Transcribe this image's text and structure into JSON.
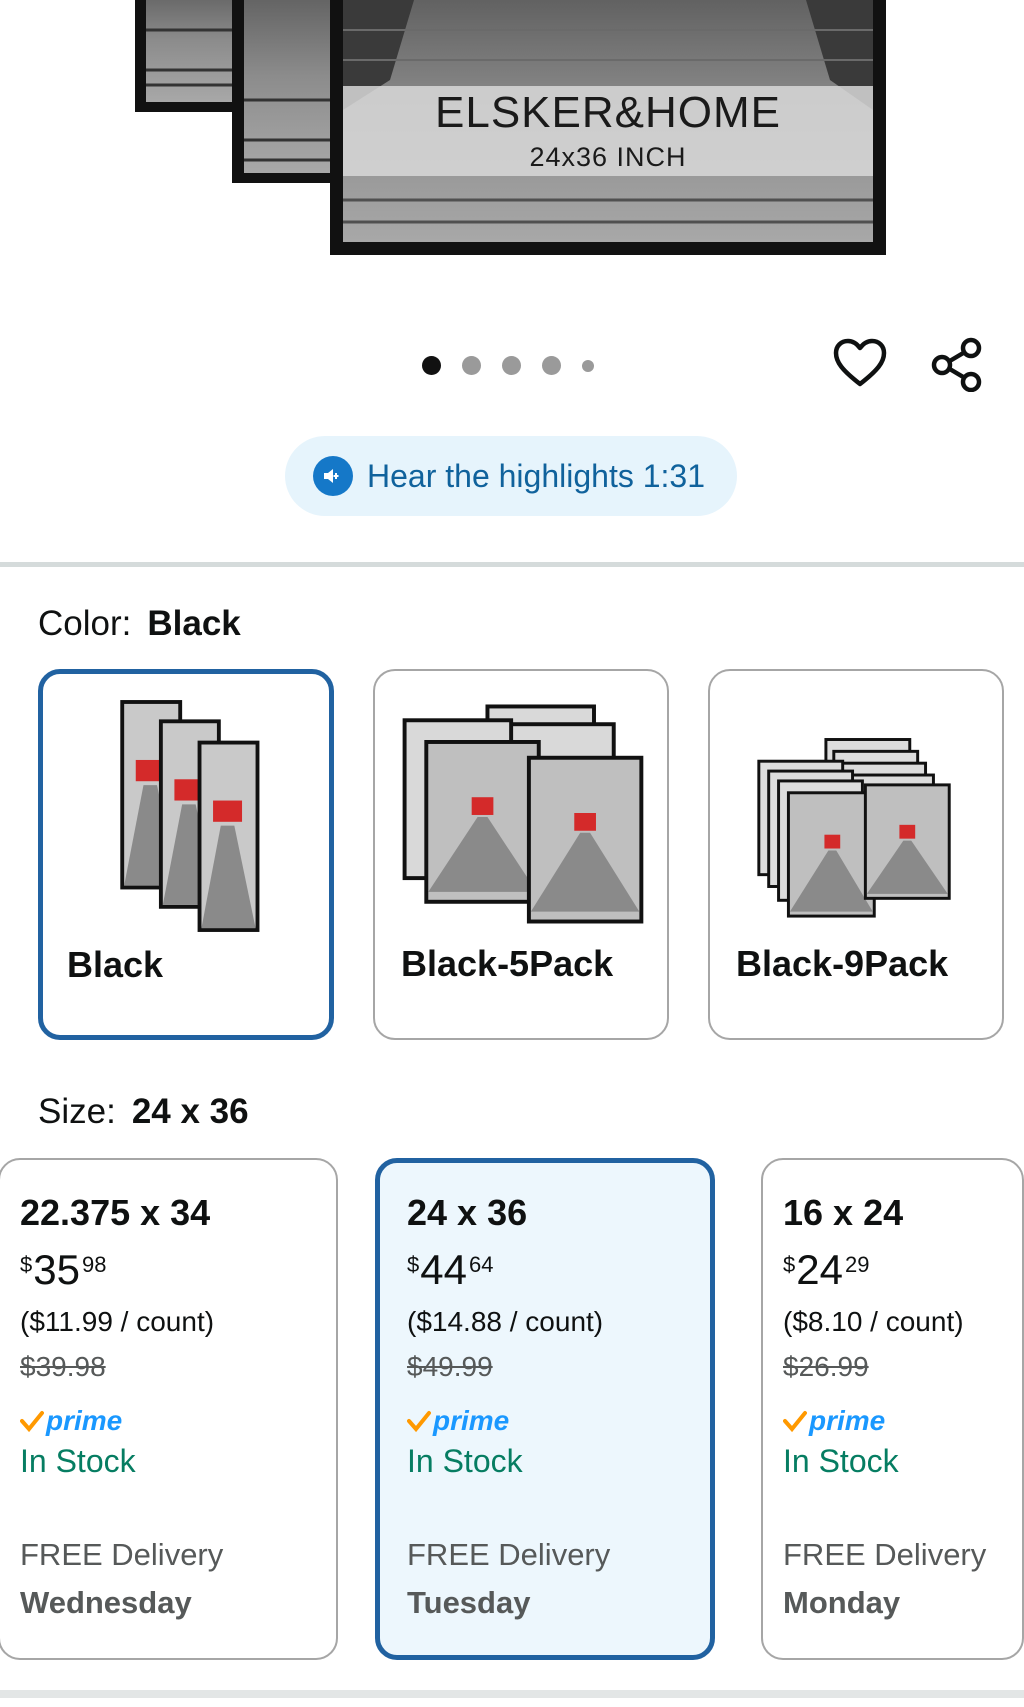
{
  "hero": {
    "brand": "ELSKER&HOME",
    "size_text": "24x36 INCH"
  },
  "carousel": {
    "dot_count": 5,
    "active_index": 0
  },
  "actions": {
    "wishlist_icon": "heart-icon",
    "share_icon": "share-icon"
  },
  "highlights": {
    "label": "Hear the highlights 1:31",
    "icon": "speaker-icon"
  },
  "color": {
    "label": "Color:",
    "selected": "Black",
    "options": [
      {
        "name": "Black"
      },
      {
        "name": "Black-5Pack"
      },
      {
        "name": "Black-9Pack"
      }
    ]
  },
  "size": {
    "label": "Size:",
    "selected": "24 x 36",
    "options": [
      {
        "name": "22.375 x 34",
        "price_symbol": "$",
        "price_whole": "35",
        "price_fraction": "98",
        "per_count": "($11.99 / count)",
        "list_price": "$39.98",
        "prime": "prime",
        "stock": "In Stock",
        "delivery": "FREE Delivery",
        "delivery_day": "Wednesday"
      },
      {
        "name": "24 x 36",
        "price_symbol": "$",
        "price_whole": "44",
        "price_fraction": "64",
        "per_count": "($14.88 / count)",
        "list_price": "$49.99",
        "prime": "prime",
        "stock": "In Stock",
        "delivery": "FREE Delivery",
        "delivery_day": "Tuesday"
      },
      {
        "name": "16 x 24",
        "price_symbol": "$",
        "price_whole": "24",
        "price_fraction": "29",
        "per_count": "($8.10 / count)",
        "list_price": "$26.99",
        "prime": "prime",
        "stock": "In Stock",
        "delivery": "FREE Delivery",
        "delivery_day": "Monday"
      }
    ]
  },
  "colors": {
    "selected_border": "#2162a1",
    "selected_bg": "#edf7fd",
    "highlight_pill_bg": "#e6f4fc",
    "highlight_text": "#10629c",
    "stock_green": "#067d62",
    "prime_blue": "#1a98ff",
    "prime_check": "#ff9900"
  }
}
